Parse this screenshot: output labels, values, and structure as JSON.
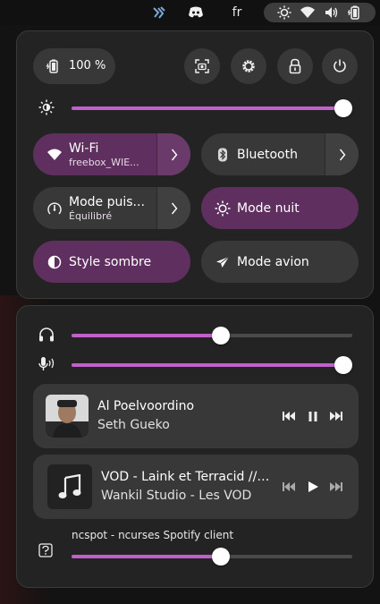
{
  "topbar": {
    "keyboard_layout": "fr"
  },
  "battery": {
    "label": "100 %"
  },
  "brightness": {
    "level": 1.0
  },
  "toggles": {
    "wifi": {
      "title": "Wi-Fi",
      "subtitle": "freebox_WIE...",
      "on": true
    },
    "bluetooth": {
      "title": "Bluetooth",
      "on": false
    },
    "power_mode": {
      "title": "Mode puis...",
      "subtitle": "Équilibré",
      "on": false
    },
    "night_mode": {
      "title": "Mode nuit",
      "on": true
    },
    "dark_style": {
      "title": "Style sombre",
      "on": true
    },
    "airplane_mode": {
      "title": "Mode avion",
      "on": false
    }
  },
  "volume": {
    "output_level": 0.55,
    "input_level": 1.0
  },
  "media": [
    {
      "title": "Al Poelvoordino",
      "artist": "Seth Gueko",
      "state": "playing"
    },
    {
      "title": "VOD - Laink et Terracid // ...",
      "artist": "Wankil Studio - Les VOD",
      "state": "paused"
    }
  ],
  "app_stream": {
    "label": "ncspot - ncurses Spotify client",
    "level": 0.55
  },
  "colors": {
    "accent": "#c061cb",
    "toggle_on": "#5e2f5f",
    "tile": "#383838",
    "panel": "#232323"
  }
}
